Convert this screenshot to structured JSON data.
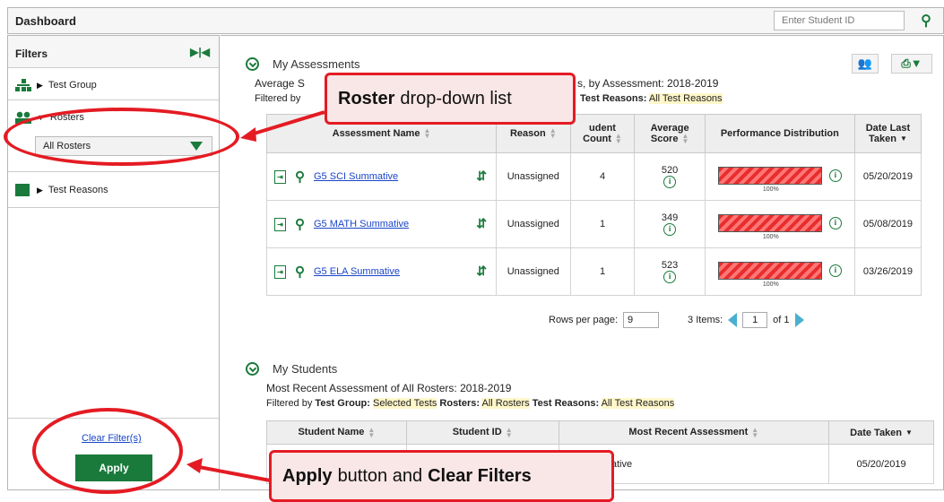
{
  "topbar": {
    "title": "Dashboard",
    "search_placeholder": "Enter Student ID",
    "search_icon": "search-icon"
  },
  "sidebar": {
    "title": "Filters",
    "items": [
      {
        "label": "Test Group",
        "icon": "hierarchy-icon"
      },
      {
        "label": "Rosters",
        "icon": "users-icon",
        "selected": "All Rosters"
      },
      {
        "label": "Test Reasons",
        "icon": "document-icon"
      }
    ],
    "clear_label": "Clear Filter(s)",
    "apply_label": "Apply"
  },
  "assessments": {
    "title": "My Assessments",
    "subtitle": "Average S",
    "subtitle_tail": "s, by Assessment: 2018-2019",
    "filtered_by": "Filtered by",
    "test_reasons_label": "Test Reasons:",
    "test_reasons_value": "All Test Reasons",
    "columns": [
      "Assessment Name",
      "Reason",
      "Student Count",
      "Average Score",
      "Performance Distribution",
      "Date Last Taken"
    ],
    "col_count_line1": "udent",
    "col_count_line2": "Count",
    "col_avg_line1": "Average",
    "col_avg_line2": "Score",
    "col_date_line1": "Date Last",
    "col_date_line2": "Taken",
    "rows": [
      {
        "name": "G5 SCI Summative",
        "reason": "Unassigned",
        "count": "4",
        "score": "520",
        "perf": "100%",
        "date": "05/20/2019"
      },
      {
        "name": "G5 MATH Summative",
        "reason": "Unassigned",
        "count": "1",
        "score": "349",
        "perf": "100%",
        "date": "05/08/2019"
      },
      {
        "name": "G5 ELA Summative",
        "reason": "Unassigned",
        "count": "1",
        "score": "523",
        "perf": "100%",
        "date": "03/26/2019"
      }
    ],
    "pager": {
      "rows_label": "Rows per page:",
      "rows_value": "9",
      "items": "3 Items:",
      "page": "1",
      "of": "of 1"
    }
  },
  "students": {
    "title": "My Students",
    "subtitle": "Most Recent Assessment of All Rosters: 2018-2019",
    "filtered_by": "Filtered by",
    "test_group_label": "Test Group:",
    "test_group_value": "Selected Tests",
    "rosters_label": "Rosters:",
    "rosters_value": "All Rosters",
    "test_reasons_label": "Test Reasons:",
    "test_reasons_value": "All Test Reasons",
    "columns": [
      "Student Name",
      "Student ID",
      "Most Recent Assessment",
      "Date Taken"
    ],
    "row": {
      "assessment": "mmative",
      "date": "05/20/2019"
    }
  },
  "callouts": {
    "roster_bold": "Roster",
    "roster_rest": "drop-down list",
    "apply_bold": "Apply",
    "apply_mid": "button and",
    "apply_bold2": "Clear Filters"
  },
  "colors": {
    "accent": "#1a7a3c",
    "callout": "#e41b23",
    "link": "#1a45c9",
    "bar": "#e82d2d"
  }
}
